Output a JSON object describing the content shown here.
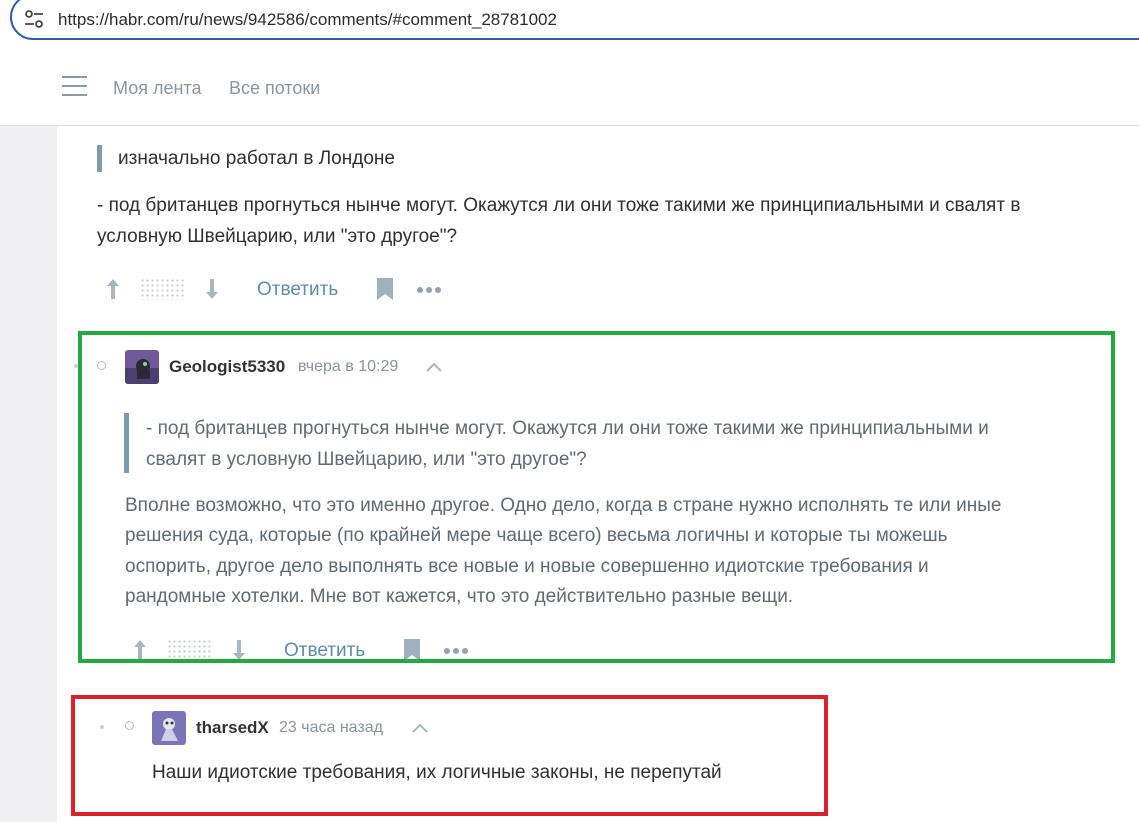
{
  "browser": {
    "url": "https://habr.com/ru/news/942586/comments/#comment_28781002",
    "site_info_icon": "tune-icon"
  },
  "header": {
    "menu_icon": "hamburger-icon",
    "nav": [
      "Моя лента",
      "Все потоки"
    ]
  },
  "comment1": {
    "quote": "изначально работал в Лондоне",
    "body_lines": [
      "- под британцев прогнуться нынче могут. Окажутся ли они тоже такими же принципиальными и свалят в",
      "условную Швейцарию, или \"это другое\"?"
    ],
    "reply_label": "Ответить"
  },
  "comment2": {
    "author": "Geologist5330",
    "time": "вчера в 10:29",
    "quote_lines": [
      "- под британцев прогнуться нынче могут. Окажутся ли они тоже такими же принципиальными и",
      "свалят в условную Швейцарию, или \"это другое\"?"
    ],
    "body_lines": [
      "Вполне возможно, что это именно другое. Одно дело, когда в стране нужно исполнять те или иные",
      "решения суда, которые (по крайней мере чаще всего) весьма логичны и которые ты можешь",
      "оспорить, другое дело выполнять все новые и новые совершенно идиотские требования и",
      "рандомные хотелки. Мне вот кажется, что это действительно разные вещи."
    ],
    "reply_label": "Ответить"
  },
  "comment3": {
    "author": "tharsedX",
    "time": "23 часа назад",
    "body": "Наши идиотские требования, их логичные законы, не перепутай"
  },
  "colors": {
    "highlight_green": "#22a844",
    "highlight_red": "#d9232c",
    "link": "#5e8dab"
  }
}
